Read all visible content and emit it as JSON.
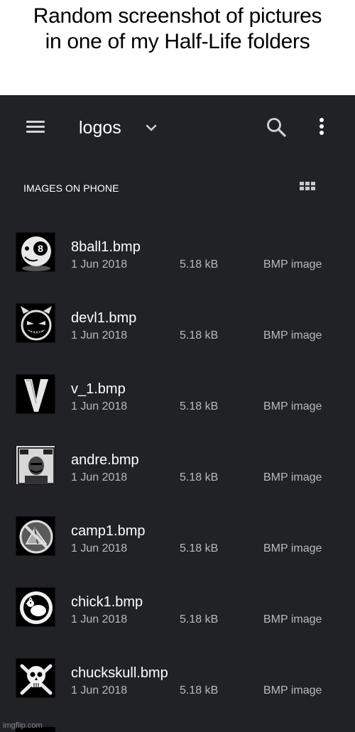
{
  "caption": {
    "line1": "Random screenshot of pictures",
    "line2": "in one of my Half-Life folders"
  },
  "app_bar": {
    "folder_name": "logos",
    "menu_icon": "hamburger-menu-icon",
    "dropdown_icon": "chevron-down-icon",
    "search_icon": "search-icon",
    "more_icon": "more-vertical-icon"
  },
  "section": {
    "label": "IMAGES ON PHONE",
    "view_icon": "grid-view-icon"
  },
  "files": [
    {
      "name": "8ball1.bmp",
      "date": "1 Jun 2018",
      "size": "5.18 kB",
      "type": "BMP image",
      "thumb_icon": "eight-ball-icon"
    },
    {
      "name": "devl1.bmp",
      "date": "1 Jun 2018",
      "size": "5.18 kB",
      "type": "BMP image",
      "thumb_icon": "devil-face-icon"
    },
    {
      "name": "v_1.bmp",
      "date": "1 Jun 2018",
      "size": "5.18 kB",
      "type": "BMP image",
      "thumb_icon": "letter-v-icon"
    },
    {
      "name": "andre.bmp",
      "date": "1 Jun 2018",
      "size": "5.18 kB",
      "type": "BMP image",
      "thumb_icon": "andre-poster-icon"
    },
    {
      "name": "camp1.bmp",
      "date": "1 Jun 2018",
      "size": "5.18 kB",
      "type": "BMP image",
      "thumb_icon": "no-camping-tent-icon"
    },
    {
      "name": "chick1.bmp",
      "date": "1 Jun 2018",
      "size": "5.18 kB",
      "type": "BMP image",
      "thumb_icon": "chicken-circle-icon"
    },
    {
      "name": "chuckskull.bmp",
      "date": "1 Jun 2018",
      "size": "5.18 kB",
      "type": "BMP image",
      "thumb_icon": "skull-crossbones-icon"
    }
  ],
  "watermark": "imgflip.com",
  "colors": {
    "background": "#212226",
    "text_primary": "#ffffff",
    "text_secondary": "#b9babd",
    "icon": "#d4d4d6"
  }
}
